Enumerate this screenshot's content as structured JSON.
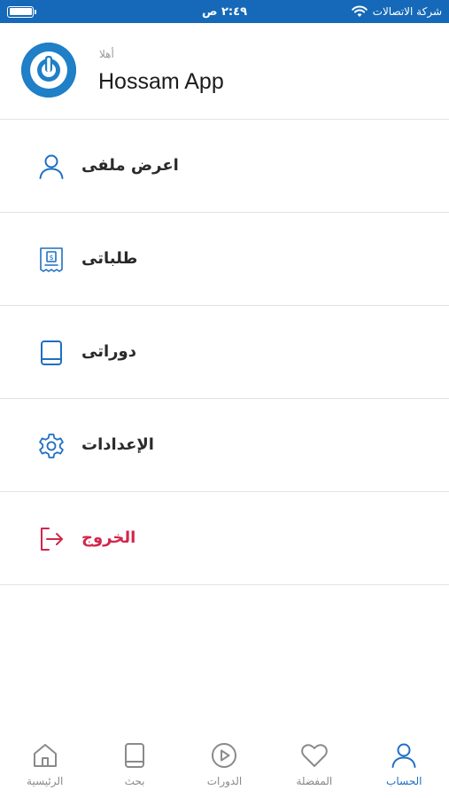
{
  "status_bar": {
    "carrier": "شركة الاتصالات",
    "time": "٢:٤٩ ص"
  },
  "profile": {
    "greeting": "أهلا",
    "name": "Hossam App"
  },
  "menu": [
    {
      "label": "اعرض ملفى",
      "icon": "user-icon"
    },
    {
      "label": "طلباتى",
      "icon": "receipt-icon"
    },
    {
      "label": "دوراتى",
      "icon": "book-icon"
    },
    {
      "label": "الإعدادات",
      "icon": "gear-icon"
    },
    {
      "label": "الخروج",
      "icon": "logout-icon"
    }
  ],
  "tabs": [
    {
      "label": "الحساب",
      "icon": "user-icon",
      "active": true
    },
    {
      "label": "المفضلة",
      "icon": "heart-icon",
      "active": false
    },
    {
      "label": "الدورات",
      "icon": "play-circle-icon",
      "active": false
    },
    {
      "label": "بحث",
      "icon": "book-icon",
      "active": false
    },
    {
      "label": "الرئيسية",
      "icon": "home-icon",
      "active": false
    }
  ],
  "colors": {
    "brand_blue": "#1569b8",
    "icon_blue": "#1f6fc4",
    "logout_red": "#d2264a",
    "inactive_gray": "#8a8a8a"
  }
}
